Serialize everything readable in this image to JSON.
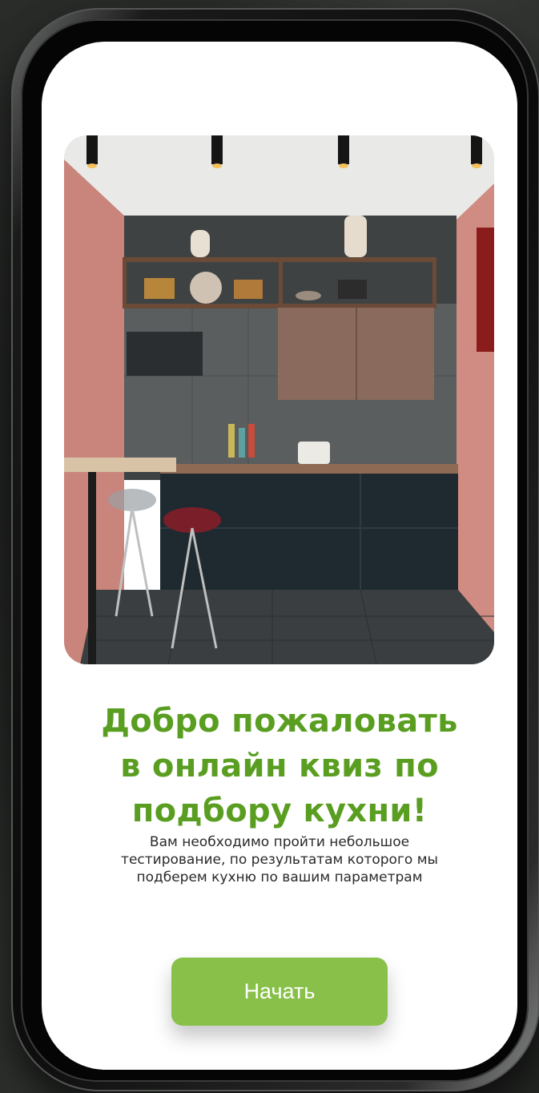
{
  "welcome": {
    "title_lines": [
      "Добро пожаловать",
      "в онлайн квиз по",
      "подбору кухни!"
    ],
    "subtitle_lines": [
      "Вам необходимо пройти небольшое",
      "тестирование, по результатам которого мы",
      "подберем кухню по вашим параметрам"
    ],
    "start_label": "Начать"
  },
  "colors": {
    "title": "#5a9e21",
    "button": "#88c04a",
    "button_text": "#ffffff",
    "screen_bg": "#ffffff"
  },
  "image": {
    "subject": "kitchen-interior-photo"
  }
}
